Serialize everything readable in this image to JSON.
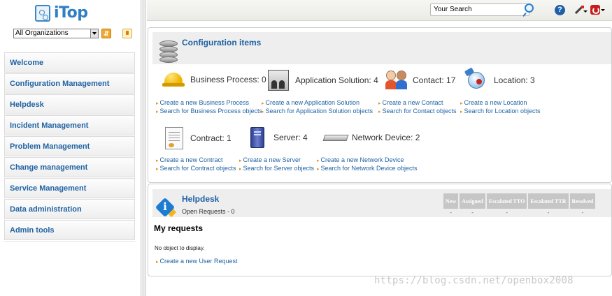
{
  "app": {
    "logo_text": "iTop"
  },
  "org_selector": {
    "selected": "All Organizations"
  },
  "menu": [
    {
      "label": "Welcome"
    },
    {
      "label": "Configuration Management"
    },
    {
      "label": "Helpdesk"
    },
    {
      "label": "Incident Management"
    },
    {
      "label": "Problem Management"
    },
    {
      "label": "Change management"
    },
    {
      "label": "Service Management"
    },
    {
      "label": "Data administration"
    },
    {
      "label": "Admin tools"
    }
  ],
  "topbar": {
    "search_placeholder": "Your Search"
  },
  "config": {
    "title": "Configuration items",
    "items": [
      {
        "label": "Business Process: 0",
        "create": "Create a new Business Process",
        "search": "Search for Business Process objects"
      },
      {
        "label": "Application Solution: 4",
        "create": "Create a new Application Solution",
        "search": "Search for Application Solution objects"
      },
      {
        "label": "Contact: 17",
        "create": "Create a new Contact",
        "search": "Search for Contact objects"
      },
      {
        "label": "Location: 3",
        "create": "Create a new Location",
        "search": "Search for Location objects"
      },
      {
        "label": "Contract: 1",
        "create": "Create a new Contract",
        "search": "Search for Contract objects"
      },
      {
        "label": "Server: 4",
        "create": "Create a new Server",
        "search": "Search for Server objects"
      },
      {
        "label": "Network Device: 2",
        "create": "Create a new Network Device",
        "search": "Search for Network Device objects"
      }
    ]
  },
  "helpdesk": {
    "title": "Helpdesk",
    "open_requests": "Open Requests - 0",
    "columns": [
      "New",
      "Assigned",
      "Escalated TTO",
      "Escalated TTR",
      "Resolved"
    ],
    "values": [
      "-",
      "-",
      "-",
      "-",
      "-"
    ],
    "my_requests": "My requests",
    "no_object": "No object to display.",
    "create_request": "Create a new User Request"
  },
  "watermark": "https://blog.csdn.net/openbox2008",
  "colors": {
    "link": "#1f62a3",
    "bullet": "#e38f1a"
  }
}
